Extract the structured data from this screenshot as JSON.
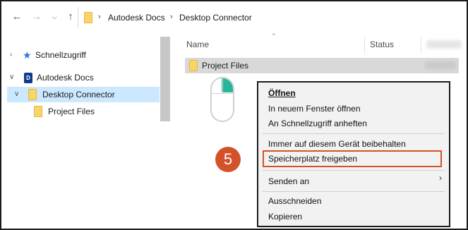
{
  "address_bar": {
    "crumbs": [
      "Autodesk Docs",
      "Desktop Connector"
    ]
  },
  "nav_pane": {
    "items": [
      {
        "label": "Schnellzugriff",
        "icon": "star-icon"
      },
      {
        "label": "Autodesk Docs",
        "icon": "autodesk-docs-icon"
      },
      {
        "label": "Desktop Connector",
        "icon": "folder-icon",
        "selected": true
      },
      {
        "label": "Project Files",
        "icon": "folder-icon"
      }
    ]
  },
  "content": {
    "columns": [
      "Name",
      "Status"
    ],
    "rows": [
      {
        "name": "Project Files",
        "selected": true
      }
    ]
  },
  "step_badge": "5",
  "context_menu": {
    "items": [
      {
        "label": "Öffnen",
        "bold": true
      },
      {
        "label": "In neuem Fenster öffnen"
      },
      {
        "label": "An Schnellzugriff anheften"
      },
      {
        "label": "Immer auf diesem Gerät beibehalten"
      },
      {
        "label": "Speicherplatz freigeben",
        "highlighted": true
      },
      {
        "label": "Senden an",
        "submenu": true
      },
      {
        "label": "Ausschneiden"
      },
      {
        "label": "Kopieren"
      }
    ]
  },
  "colors": {
    "accent": "#d4522a",
    "selection": "#cce8ff",
    "mouse_button": "#27b69a"
  }
}
